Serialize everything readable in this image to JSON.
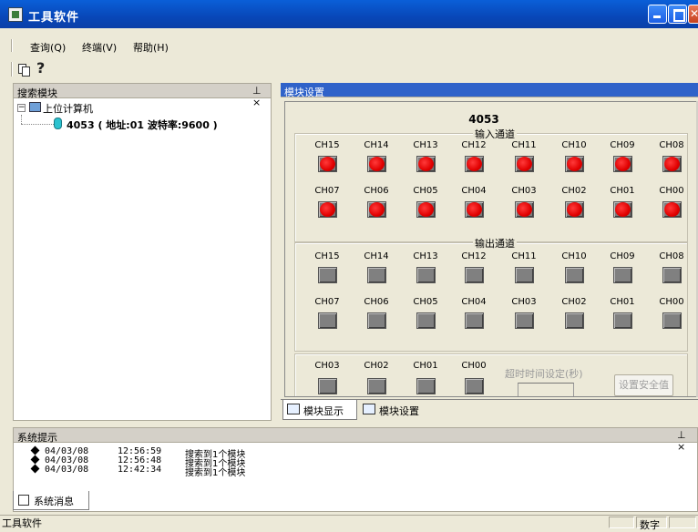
{
  "window": {
    "title": "工具软件"
  },
  "menu": [
    "查询(Q)",
    "终端(V)",
    "帮助(H)"
  ],
  "toolbar": {
    "icons": [
      "copy-icon",
      "help-icon"
    ],
    "help_glyph": "?"
  },
  "left_pane": {
    "title": "搜索模块",
    "pin": "⊥ ×",
    "tree": {
      "root": "上位计算机",
      "child": "4053 ( 地址:01  波特率:9600 )"
    }
  },
  "right_pane": {
    "title": "模块设置",
    "module_name": "4053",
    "input_group": {
      "title": "输入通道",
      "row1": [
        "CH15",
        "CH14",
        "CH13",
        "CH12",
        "CH11",
        "CH10",
        "CH09",
        "CH08"
      ],
      "row2": [
        "CH07",
        "CH06",
        "CH05",
        "CH04",
        "CH03",
        "CH02",
        "CH01",
        "CH00"
      ],
      "states": "all-on"
    },
    "output_group": {
      "title": "输出通道",
      "row1": [
        "CH15",
        "CH14",
        "CH13",
        "CH12",
        "CH11",
        "CH10",
        "CH09",
        "CH08"
      ],
      "row2": [
        "CH07",
        "CH06",
        "CH05",
        "CH04",
        "CH03",
        "CH02",
        "CH01",
        "CH00"
      ],
      "states": "all-off"
    },
    "safe_group": {
      "channels": [
        "CH03",
        "CH02",
        "CH01",
        "CH00"
      ],
      "timeout_label": "超时时间设定(秒)",
      "timeout_value": "",
      "safe_button": "设置安全值"
    },
    "tabs": [
      "模块显示",
      "模块设置"
    ]
  },
  "messages": {
    "title": "系统提示",
    "pin": "⊥ ×",
    "rows": [
      {
        "date": "04/03/08",
        "time": "12:56:59",
        "text": "搜索到1个模块"
      },
      {
        "date": "04/03/08",
        "time": "12:56:48",
        "text": "搜索到1个模块"
      },
      {
        "date": "04/03/08",
        "time": "12:42:34",
        "text": "搜索到1个模块"
      }
    ],
    "tab": "系统消息"
  },
  "status": {
    "text": "工具软件",
    "indicator": "数字"
  },
  "colors": {
    "led_on": "#e00000",
    "led_off": "#808080",
    "pane_head": "#2f62c9",
    "title_bar": "#0847b8"
  }
}
